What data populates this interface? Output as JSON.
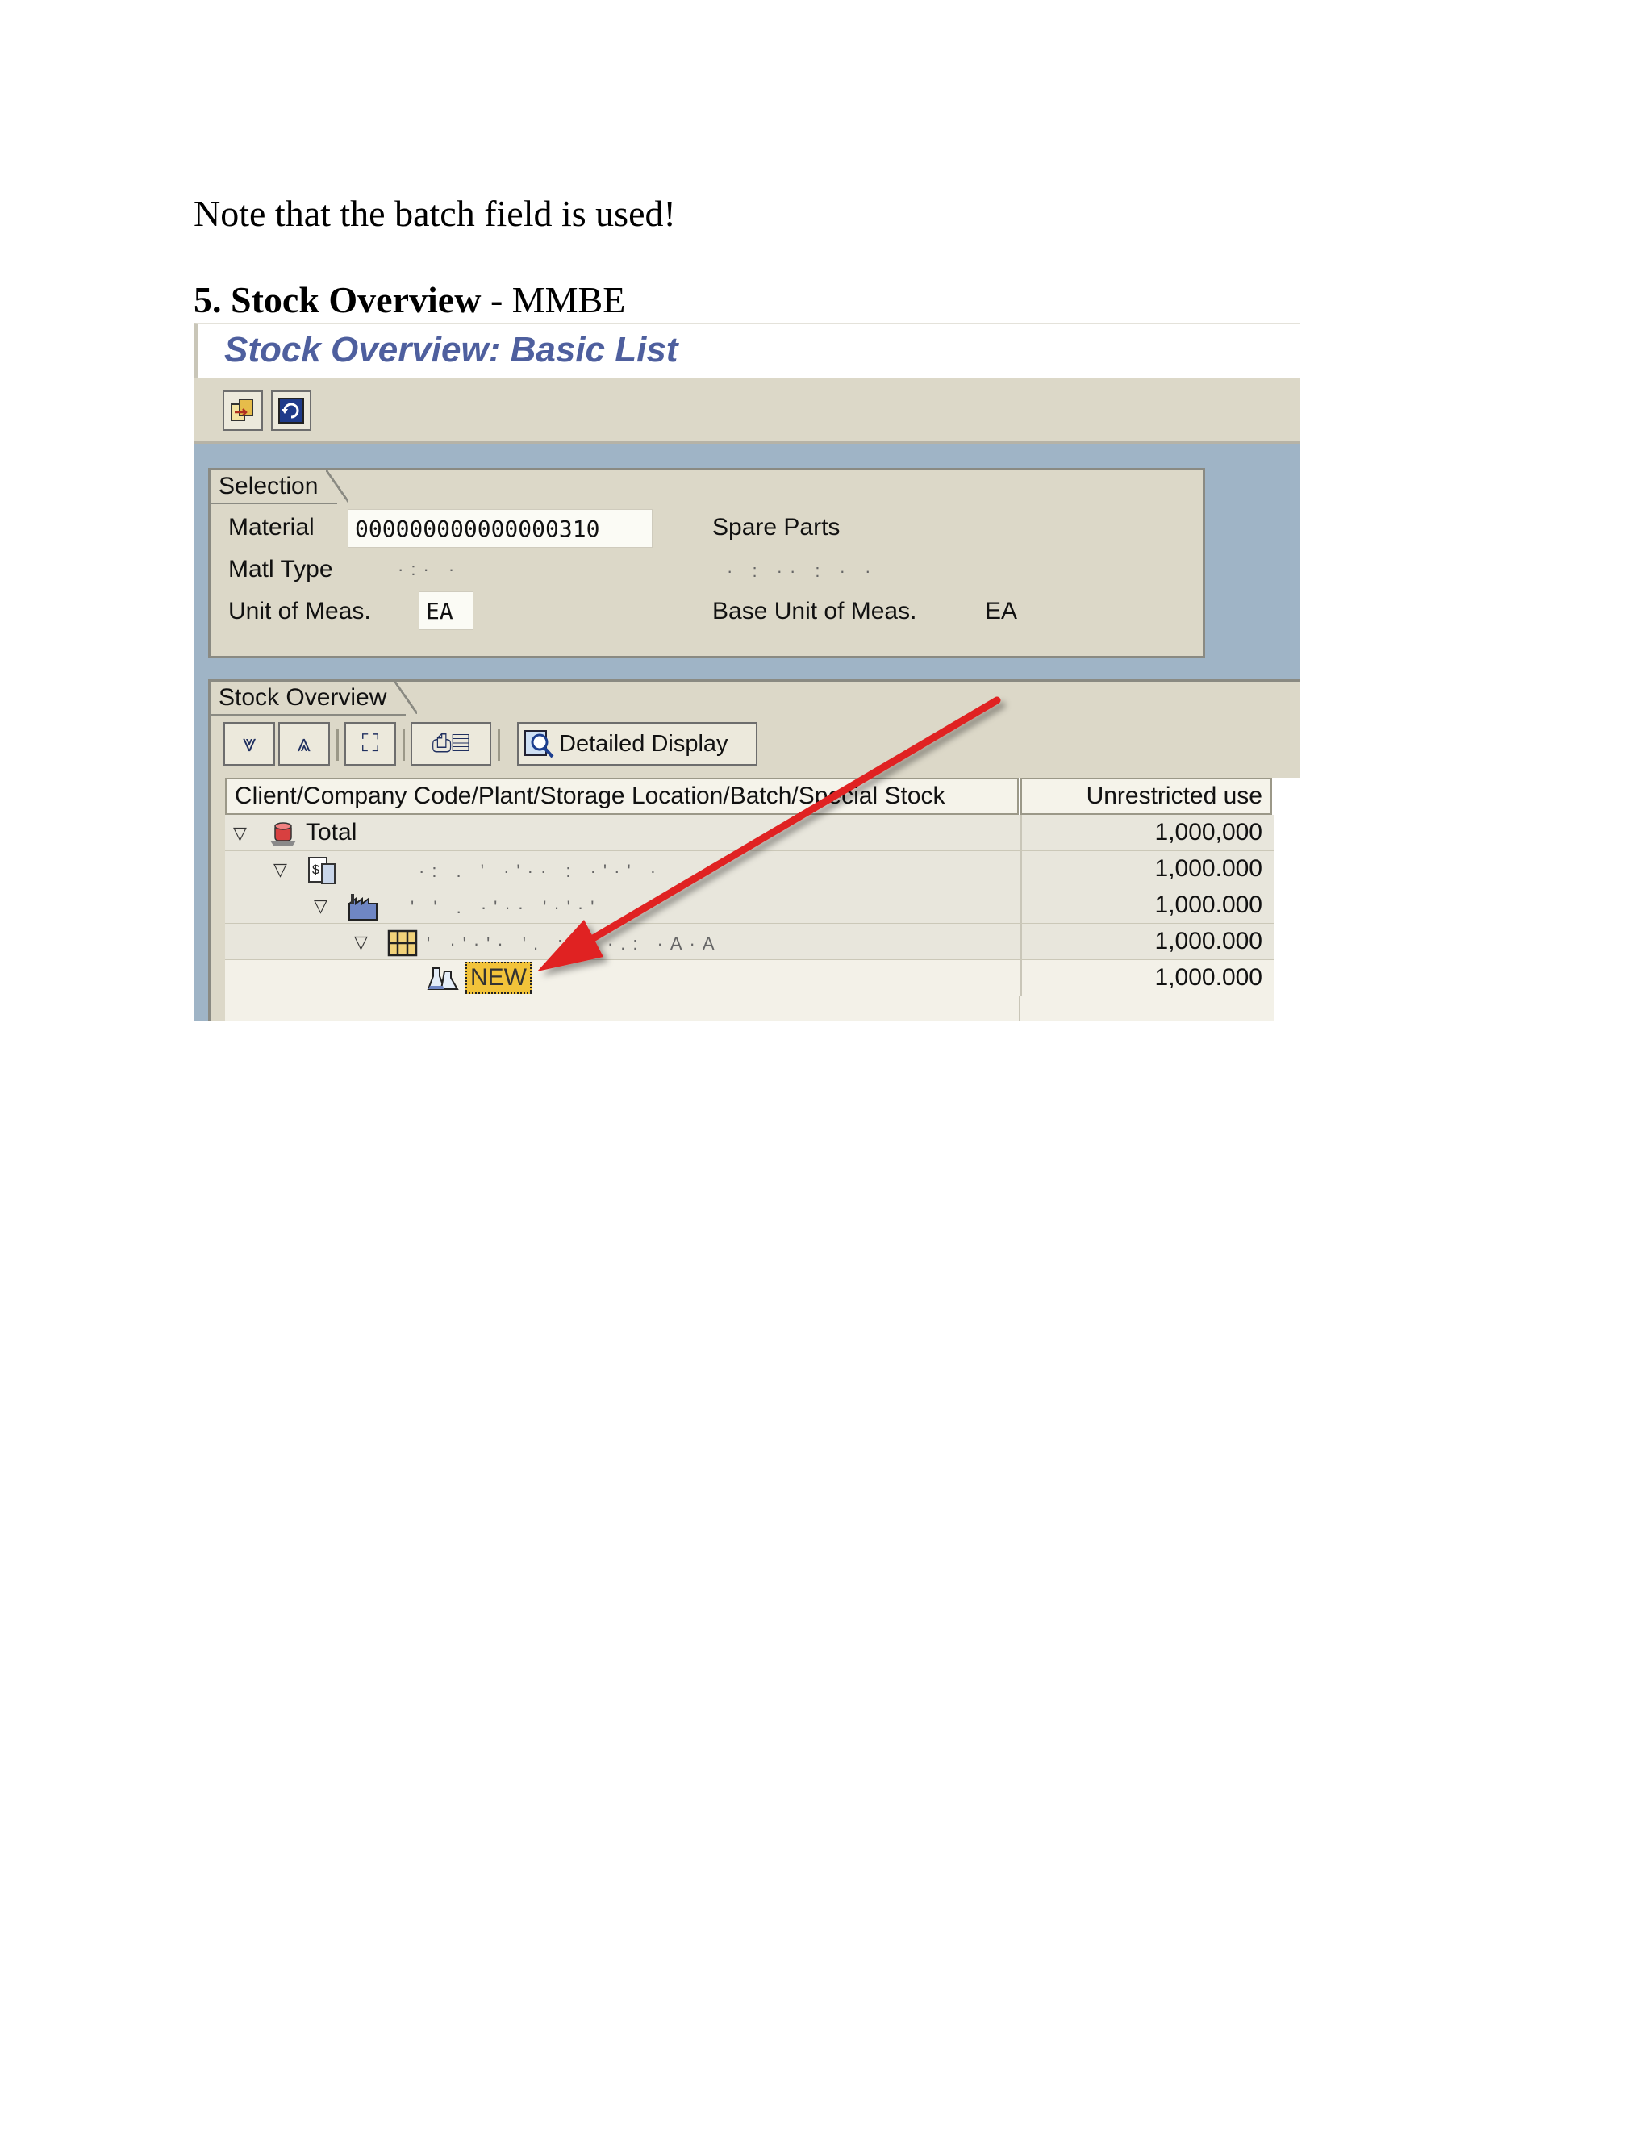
{
  "document": {
    "note": "Note that the batch field is used!",
    "section_number": "5.",
    "section_title": "Stock Overview",
    "section_suffix": " - MMBE"
  },
  "window": {
    "title": "Stock Overview: Basic List",
    "toolbar": {
      "icons": [
        "export-icon",
        "refresh-icon"
      ]
    }
  },
  "selection": {
    "frame_title": "Selection",
    "material_label": "Material",
    "material_value": "000000000000000310",
    "material_desc": "Spare Parts",
    "matl_type_label": "Matl Type",
    "unit_label": "Unit of Meas.",
    "unit_value": "EA",
    "base_unit_label": "Base Unit of Meas.",
    "base_unit_value": "EA"
  },
  "stock_overview": {
    "frame_title": "Stock Overview",
    "detail_button": "Detailed Display",
    "col_header_hierarchy": "Client/Company Code/Plant/Storage Location/Batch/Special Stock",
    "col_header_unrestricted": "Unrestricted use",
    "rows": [
      {
        "label": "Total",
        "value": "1,000,000",
        "icon": "total-icon",
        "level": 0
      },
      {
        "label": "",
        "value": "1,000.000",
        "icon": "company-code-icon",
        "level": 1
      },
      {
        "label": "",
        "value": "1,000.000",
        "icon": "plant-icon",
        "level": 2
      },
      {
        "label": "",
        "value": "1,000.000",
        "icon": "storage-location-icon",
        "level": 3
      },
      {
        "label": "NEW",
        "value": "1,000.000",
        "icon": "batch-icon",
        "level": 4
      }
    ]
  },
  "colors": {
    "title": "#4e5f9e",
    "sap_gray": "#dcd8c8",
    "batch_highlight": "#f2c33a",
    "arrow": "#e02020"
  }
}
